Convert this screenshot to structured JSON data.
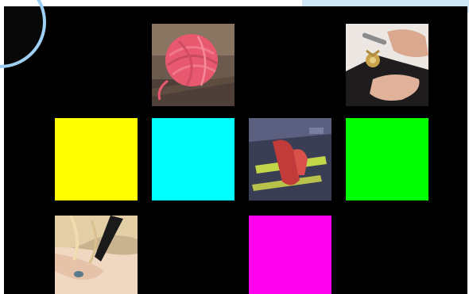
{
  "board": {
    "background": "#000000",
    "tiles": [
      {
        "kind": "photo",
        "subject": "pink-yarn-ball"
      },
      {
        "kind": "photo",
        "subject": "hands-with-medal"
      },
      {
        "kind": "color",
        "color": "#ffff00"
      },
      {
        "kind": "color",
        "color": "#00ffff"
      },
      {
        "kind": "photo",
        "subject": "firefighter-gear"
      },
      {
        "kind": "color",
        "color": "#00ff00"
      },
      {
        "kind": "photo",
        "subject": "blonde-child"
      },
      {
        "kind": "color",
        "color": "#ff00ee"
      }
    ]
  },
  "controls": {
    "play_icon": "play-icon",
    "accent": "#2f8fd8",
    "ring": "#9fd0f4"
  }
}
